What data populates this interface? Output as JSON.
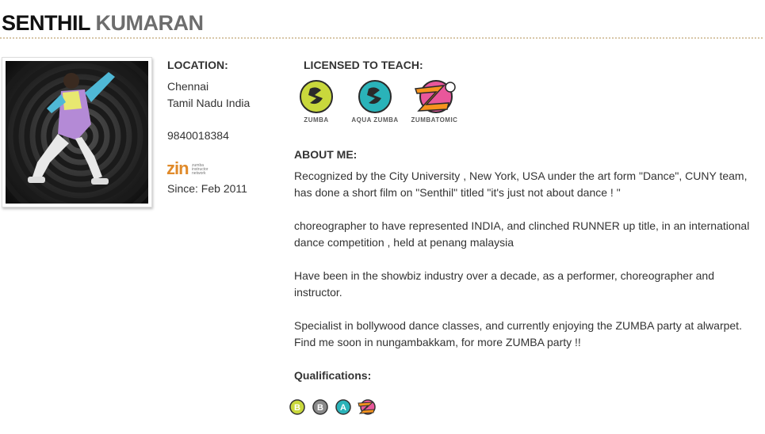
{
  "profile": {
    "first_name": "SENTHIL",
    "last_name": "KUMARAN",
    "location_label": "LOCATION:",
    "city": "Chennai",
    "region": "Tamil Nadu India",
    "phone": "9840018384",
    "zin_logo_text": "zin",
    "zin_logo_sub": "zumba instructor network",
    "since": "Since: Feb 2011"
  },
  "licenses": {
    "label": "LICENSED TO TEACH:",
    "items": [
      {
        "name": "ZUMBA",
        "icon": "zumba-icon",
        "color": "#c9d83c"
      },
      {
        "name": "AQUA ZUMBA",
        "icon": "aqua-zumba-icon",
        "color": "#2ab3b9"
      },
      {
        "name": "ZUMBATOMIC",
        "icon": "zumbatomic-icon",
        "color": "#e9579b"
      }
    ]
  },
  "about": {
    "label": "ABOUT ME:",
    "paragraphs": [
      "Recognized by the City University , New York, USA under the art form \"Dance\", CUNY team, has done a short film on \"Senthil\" titled \"it's just not about dance ! \"",
      "choreographer to have represented INDIA, and clinched RUNNER up title, in an international dance competition , held at penang malaysia",
      "Have been in the showbiz industry over a decade, as a performer, choreographer and instructor.",
      "Specialist in bollywood dance classes, and currently enjoying the ZUMBA party at alwarpet. Find me soon in nungambakkam, for more ZUMBA party !!"
    ]
  },
  "qualifications": {
    "label": "Qualifications:",
    "icons": [
      {
        "icon": "basic-1-badge-icon",
        "letter": "B",
        "color": "#c9d83c"
      },
      {
        "icon": "basic-2-badge-icon",
        "letter": "B",
        "color": "#8a8a8a"
      },
      {
        "icon": "aqua-badge-icon",
        "letter": "A",
        "color": "#2ab3b9"
      },
      {
        "icon": "zumbatomic-badge-icon",
        "letter": "Z",
        "color": "#e9579b"
      }
    ]
  }
}
